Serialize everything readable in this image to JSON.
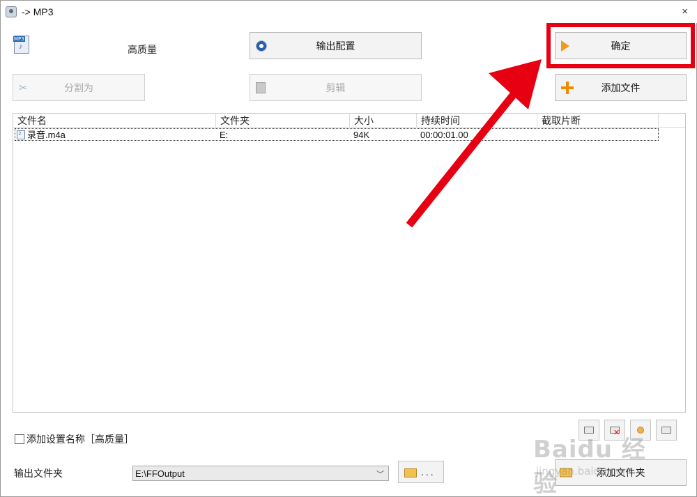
{
  "window": {
    "title": "-> MP3",
    "close_label": "×"
  },
  "profile": {
    "quality_label": "高质量"
  },
  "buttons": {
    "output_config": "输出配置",
    "ok": "确定",
    "split": "分割为",
    "edit": "剪辑",
    "add_file": "添加文件",
    "add_folder": "添加文件夹"
  },
  "file_list": {
    "columns": [
      "文件名",
      "文件夹",
      "大小",
      "持续时间",
      "截取片断"
    ],
    "rows": [
      {
        "name": "录音.m4a",
        "folder": "E:",
        "size": "94K",
        "duration": "00:00:01.00",
        "clip": ""
      }
    ]
  },
  "options": {
    "add_setting_name_label": "添加设置名称［高质量］",
    "add_setting_name_checked": false
  },
  "output": {
    "label": "输出文件夹",
    "folder_value": "E:\\FFOutput",
    "browse_label": "..."
  },
  "watermark": {
    "logo": "Baidu 经验",
    "site": "jingyan.baidu.com"
  },
  "colors": {
    "highlight": "#e60012",
    "arrow": "#e60012"
  }
}
